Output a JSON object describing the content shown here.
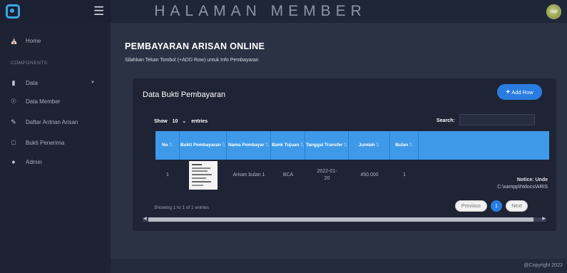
{
  "app": {
    "top_title": "HALAMAN MEMBER",
    "avatar_text": "Hall"
  },
  "sidebar": {
    "section_label": "COMPONENTS",
    "items": [
      {
        "label": "Home",
        "icon": "home-icon"
      },
      {
        "label": "Data",
        "icon": "document-icon"
      },
      {
        "label": "Data Member",
        "icon": "users-icon"
      },
      {
        "label": "Daftar Antrian Arisan",
        "icon": "pen-icon"
      },
      {
        "label": "Bukti Penerima",
        "icon": "clipboard-icon"
      },
      {
        "label": "Admin",
        "icon": "user-icon"
      }
    ]
  },
  "page": {
    "title": "PEMBAYARAN ARISAN ONLINE",
    "subtitle": "Silahkan Tekan Tombol (+ADD Row) untuk Info Pembayaran"
  },
  "card": {
    "title": "Data Bukti Pembayaran",
    "add_button": "Add Row"
  },
  "table": {
    "show_label": "Show",
    "entries_value": "10",
    "entries_label": "entries",
    "search_label": "Search:",
    "headers": [
      "No",
      "Bukti Pembayaran",
      "Nama Pembayar",
      "Bank Tujuan",
      "Tanggal Transfer",
      "Jumlah",
      "Bulan",
      ""
    ],
    "rows": [
      {
        "no": "1",
        "nama": "Arisan bulan 1",
        "bank": "BCA",
        "tanggal": "2022-01-20",
        "jumlah": "450.000",
        "bulan": "1",
        "notice_label": "Notice: Unde",
        "notice_path": "C:\\xampp\\htdocs\\ARIS"
      }
    ],
    "info": "Showing 1 to 1 of 1 entries",
    "pagination": {
      "prev": "Previous",
      "current": "1",
      "next": "Next"
    }
  },
  "footer": {
    "text": "@Copyright 2022"
  },
  "colors": {
    "accent": "#2a7de0",
    "table_header": "#3e9ae8",
    "sidebar_bg": "#1d2333",
    "main_bg": "#2a3244"
  }
}
